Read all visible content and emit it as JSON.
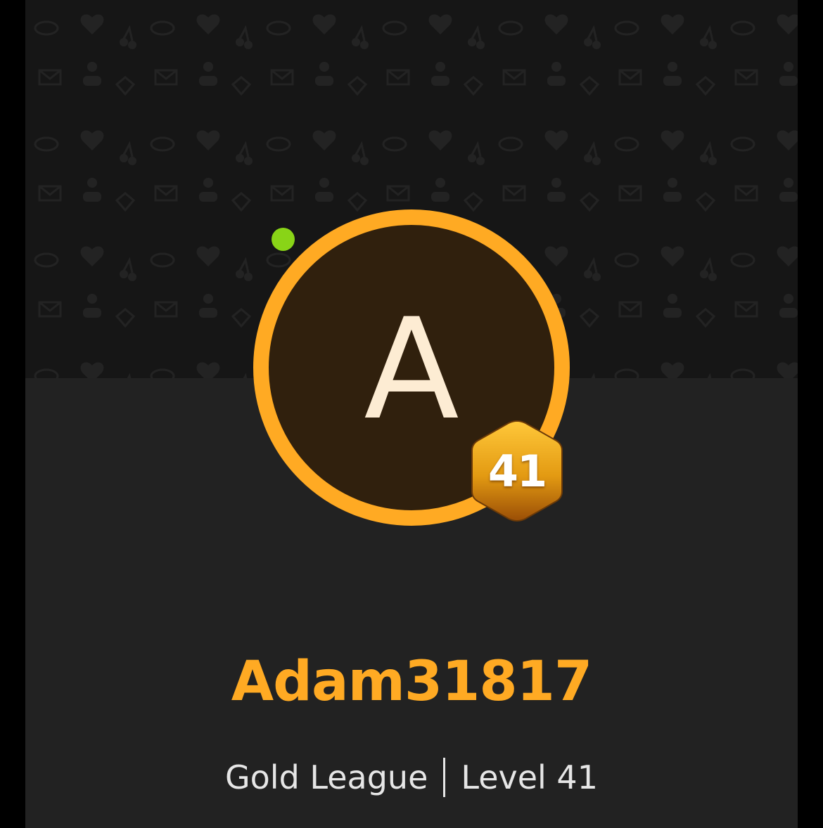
{
  "profile": {
    "avatar_initial": "A",
    "username": "Adam31817",
    "league": "Gold League",
    "level_text": "Level 41",
    "level_badge": "41",
    "online": true
  },
  "colors": {
    "accent": "#ffaa23",
    "online": "#89d417",
    "avatar_bg": "#30200d",
    "text_light": "#e6e6e6"
  },
  "icons": {
    "banner_pattern": "doodle-pattern-icon",
    "status": "online-status-dot",
    "badge": "hexagon-level-badge-icon"
  }
}
